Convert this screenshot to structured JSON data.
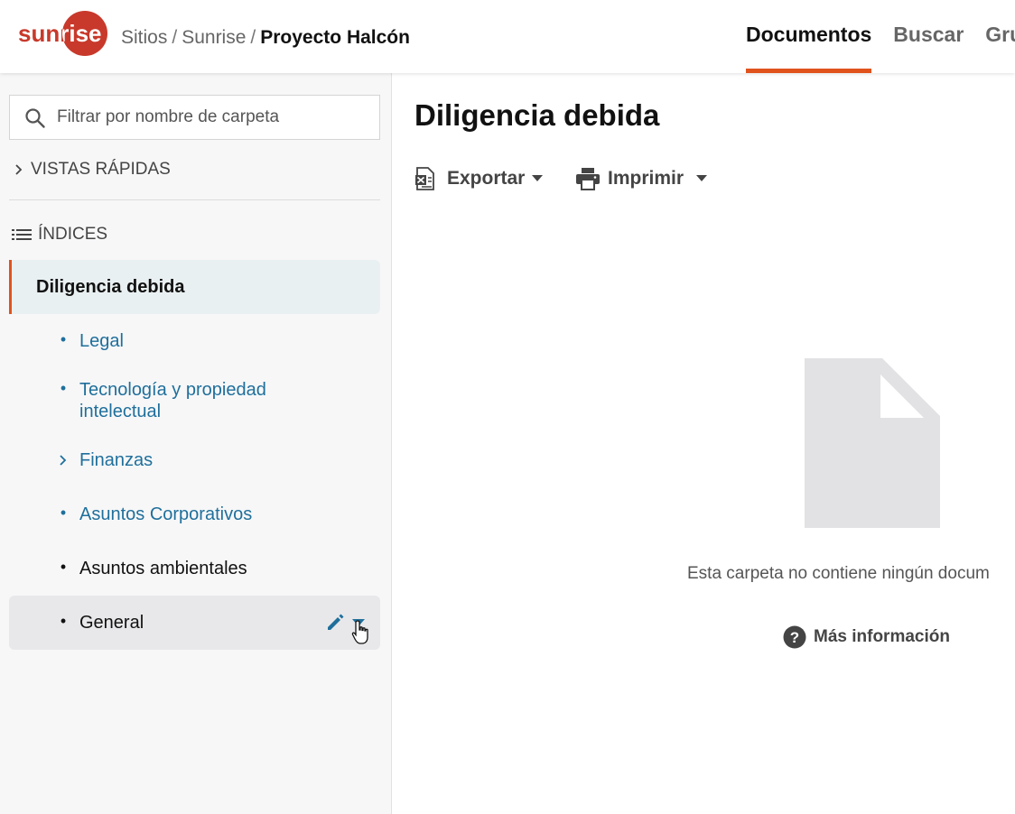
{
  "brand": {
    "logo_text": "sunrise",
    "logo_color": "#c8392b"
  },
  "breadcrumb": {
    "items": [
      "Sitios",
      "Sunrise"
    ],
    "current": "Proyecto Halcón"
  },
  "nav": {
    "tabs": [
      "Documentos",
      "Buscar",
      "Gru"
    ],
    "active_index": 0,
    "accent": "#e0531d"
  },
  "sidebar": {
    "filter_placeholder": "Filtrar por nombre de carpeta",
    "quick_views_label": "VISTAS RÁPIDAS",
    "index_label": "ÍNDICES",
    "root_folder": "Diligencia debida",
    "folders": [
      {
        "label": "Legal",
        "marker": "bullet"
      },
      {
        "label": "Tecnología y propiedad",
        "label_line2": "intelectual",
        "marker": "bullet"
      },
      {
        "label": "Finanzas",
        "marker": "chevron"
      },
      {
        "label": "Asuntos Corporativos",
        "marker": "bullet"
      },
      {
        "label": "Asuntos ambientales",
        "marker": "bullet"
      },
      {
        "label": "General",
        "marker": "bullet",
        "hovered": true
      }
    ]
  },
  "main": {
    "title": "Diligencia debida",
    "toolbar": {
      "export_label": "Exportar",
      "print_label": "Imprimir"
    },
    "empty_message": "Esta carpeta no contiene ningún docum",
    "more_info_label": "Más información"
  }
}
